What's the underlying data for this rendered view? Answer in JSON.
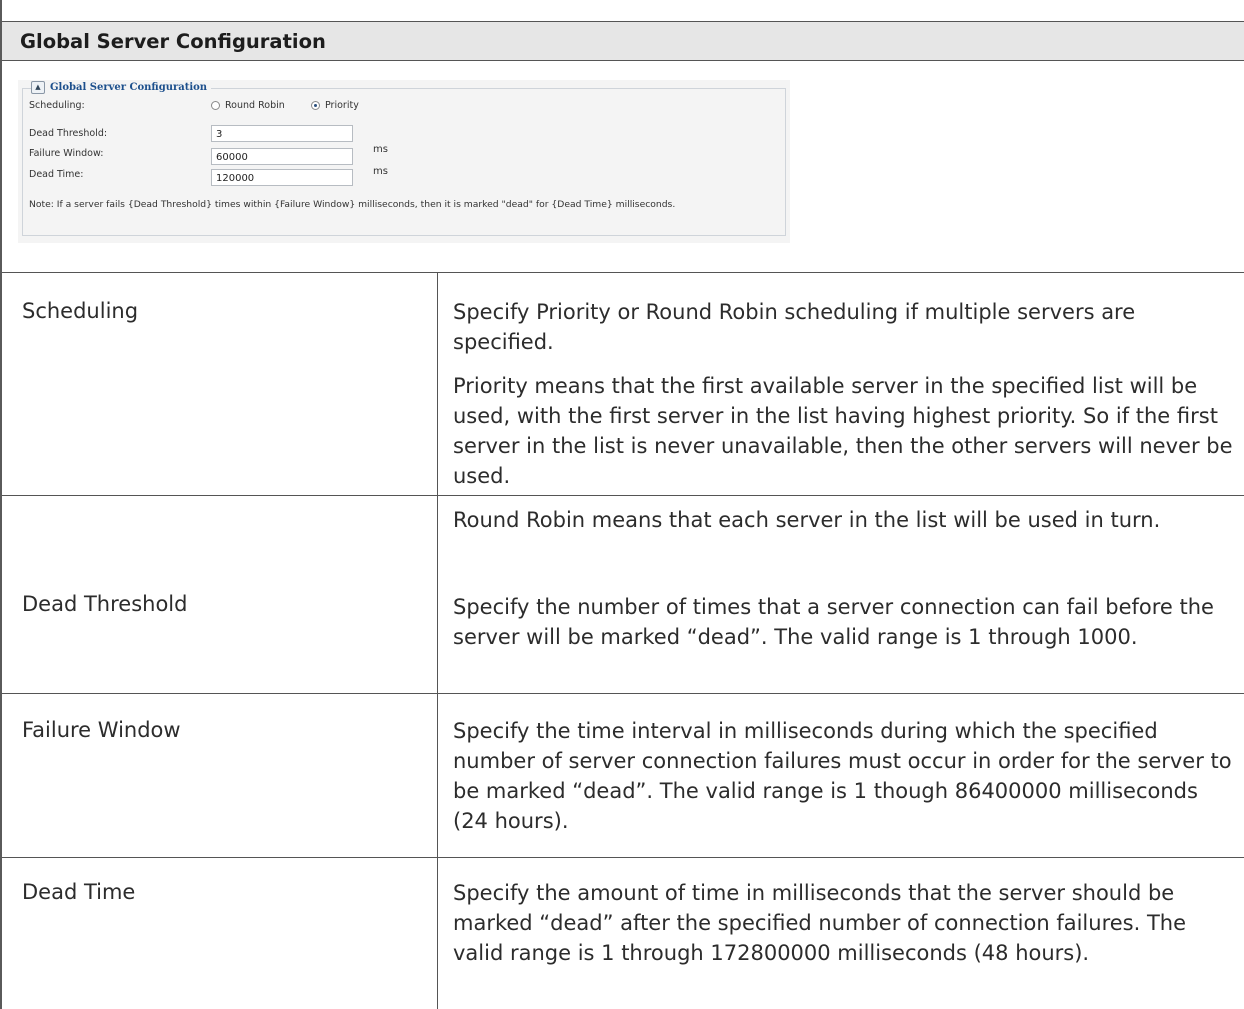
{
  "title": "Global Server Configuration",
  "screenshot": {
    "legend": "Global Server Configuration",
    "scheduling_label": "Scheduling:",
    "scheduling_options": [
      "Round Robin",
      "Priority"
    ],
    "scheduling_selected": "Priority",
    "dead_threshold_label": "Dead Threshold:",
    "dead_threshold_value": "3",
    "failure_window_label": "Failure Window:",
    "failure_window_value": "60000",
    "failure_window_unit": "ms",
    "dead_time_label": "Dead Time:",
    "dead_time_value": "120000",
    "dead_time_unit": "ms",
    "note": "Note: If a server fails {Dead Threshold} times within {Failure Window} milliseconds, then it is marked \"dead\" for {Dead Time} milliseconds."
  },
  "rows": [
    {
      "term": "Scheduling",
      "paragraphs": [
        "Specify Priority or Round Robin scheduling if multiple servers are specified.",
        "Priority means that the first available server in the specified list will be used, with the first server in the list having highest priority. So if the first server in the list is never unavailable, then the other servers will never be used.",
        "Round Robin means that each server in the list will be used in turn."
      ]
    },
    {
      "term": "Dead Threshold",
      "paragraphs": [
        "Specify the number of times that a server connection can fail before the server will be marked “dead”. The valid range is 1 through 1000."
      ]
    },
    {
      "term": "Failure Window",
      "paragraphs": [
        "Specify the time interval in milliseconds during which the specified number of server connection failures must occur in order for the server to be marked “dead”. The valid range is 1 though 86400000 milliseconds (24 hours)."
      ]
    },
    {
      "term": "Dead Time",
      "paragraphs": [
        "Specify the amount of time in milliseconds that the server should be marked “dead” after the specified number of connection failures. The valid range is 1 through 172800000 milliseconds (48 hours)."
      ]
    }
  ]
}
